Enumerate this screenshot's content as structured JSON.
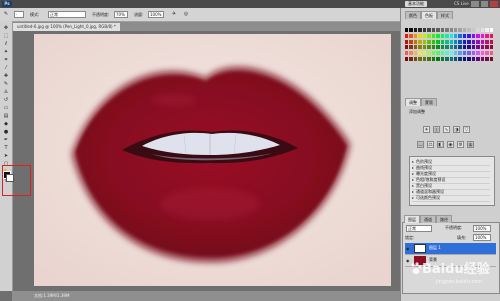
{
  "app": {
    "logo_text": "Ps",
    "workspace_button": "基本功能",
    "cs_live": "CS Live"
  },
  "options_bar": {
    "mode_label": "模式:",
    "mode_value": "正常",
    "opacity_label": "不透明度:",
    "opacity_value": "70%",
    "flow_label": "流量:",
    "flow_value": "100%"
  },
  "document": {
    "tab_label": "untitled-6.jpg @ 100% (Pen_Light_0.jpg, RGB/8) *"
  },
  "status_bar": {
    "text": "文档:1.39M/1.39M"
  },
  "right_panel": {
    "tabs": [
      "颜色",
      "色板",
      "样式"
    ],
    "adjust_tabs": [
      "调整",
      "蒙版"
    ],
    "adjust_title": "添加调整",
    "presets": [
      "色阶预设",
      "曲线预设",
      "曝光度预设",
      "色相/饱和度预设",
      "黑白预设",
      "通道混和器预设",
      "可选颜色预设"
    ]
  },
  "layers_panel": {
    "tabs": [
      "图层",
      "通道",
      "路径"
    ],
    "blend_mode": "正常",
    "opacity_label": "不透明度:",
    "opacity_value": "100%",
    "fill_label": "填充:",
    "fill_value": "100%",
    "lock_label": "锁定:",
    "layers": [
      {
        "name": "图层 1",
        "selected": true
      },
      {
        "name": "背景",
        "selected": false
      }
    ]
  },
  "watermark": {
    "brand": "Baidu经验",
    "url": "jingyan.baidu.com"
  },
  "colors": {
    "lip_red": "#8e0f22",
    "lip_dark": "#5a0514",
    "skin": "#efe1dc",
    "selection_blue": "#2f6fd8",
    "highlight_red": "#e02020"
  },
  "icons": {
    "tools": [
      "move-icon",
      "marquee-icon",
      "lasso-icon",
      "quick-select-icon",
      "crop-icon",
      "eyedropper-icon",
      "healing-brush-icon",
      "brush-icon",
      "clone-stamp-icon",
      "history-brush-icon",
      "eraser-icon",
      "gradient-icon",
      "blur-icon",
      "dodge-icon",
      "pen-icon",
      "type-icon",
      "path-select-icon",
      "shape-icon",
      "hand-icon",
      "zoom-icon"
    ]
  }
}
